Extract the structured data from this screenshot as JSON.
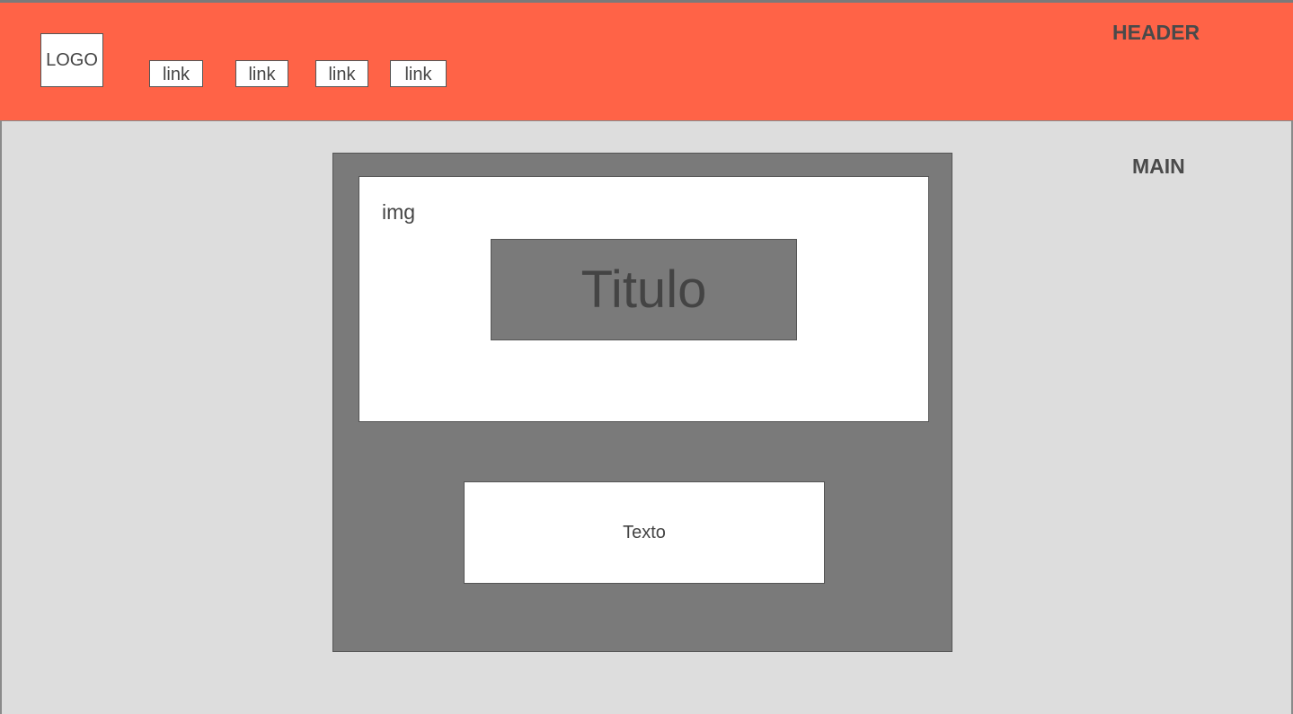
{
  "header": {
    "label": "HEADER",
    "logo_text": "LOGO",
    "nav_links": [
      "link",
      "link",
      "link",
      "link"
    ]
  },
  "main": {
    "label": "MAIN",
    "card": {
      "img_label": "img",
      "title": "Titulo",
      "text": "Texto"
    }
  },
  "colors": {
    "header_bg": "#ff6347",
    "main_bg": "#dddddd",
    "card_bg": "#7a7a7a",
    "box_bg": "#ffffff"
  }
}
